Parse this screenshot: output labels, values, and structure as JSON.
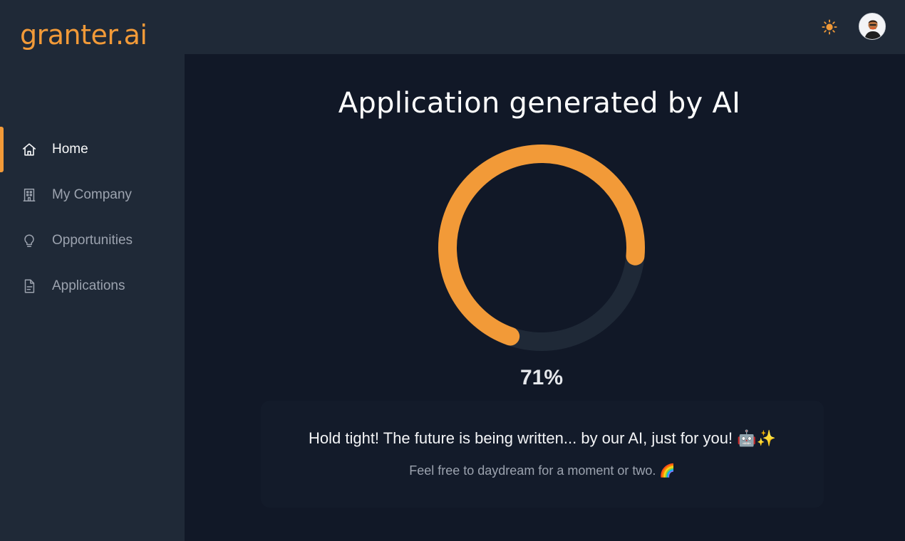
{
  "brand": {
    "logo_text": "granter.ai",
    "accent_color": "#f29a38"
  },
  "header": {
    "theme_icon": "sun-icon",
    "avatar": "user-avatar"
  },
  "sidebar": {
    "items": [
      {
        "label": "Home",
        "icon": "home-icon",
        "active": true
      },
      {
        "label": "My Company",
        "icon": "building-icon",
        "active": false
      },
      {
        "label": "Opportunities",
        "icon": "lightbulb-icon",
        "active": false
      },
      {
        "label": "Applications",
        "icon": "document-icon",
        "active": false
      }
    ]
  },
  "main": {
    "title": "Application generated by AI",
    "progress": {
      "percent": 71,
      "label": "71%",
      "track_color": "#1f2937",
      "fill_color": "#f29a38"
    },
    "message": "Hold tight! The future is being written... by our AI, just for you! 🤖✨",
    "submessage": "Feel free to daydream for a moment or two. 🌈"
  }
}
